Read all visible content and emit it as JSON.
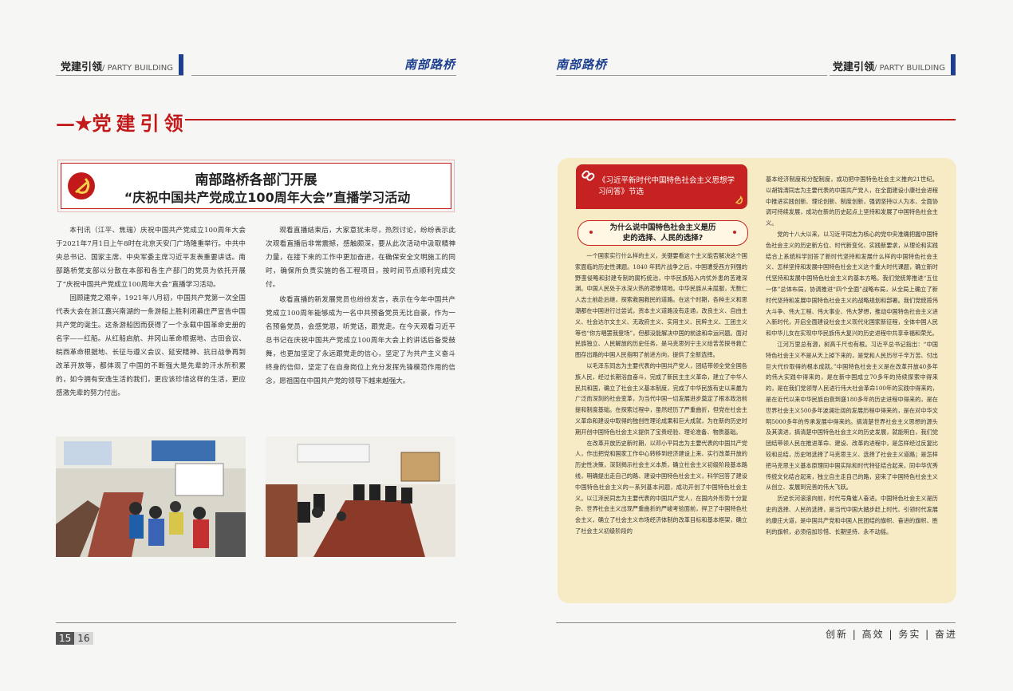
{
  "header": {
    "left_tab_cn": "党建引领",
    "left_tab_en": "/ PARTY BUILDING",
    "right_tab_cn": "党建引领",
    "right_tab_en": "/ PARTY BUILDING",
    "magazine_left": "南部路桥",
    "magazine_right": "南部路桥"
  },
  "section": {
    "prefix": "—★",
    "title": "党建引领"
  },
  "article": {
    "headline_1": "南部路桥各部门开展",
    "headline_2": "“庆祝中国共产党成立100周年大会”直播学习活动",
    "col1_p1": "本刊讯（江平、焦瑞）庆祝中国共产党成立100周年大会于2021年7月1日上午8时在北京天安门广场隆重举行。中共中央总书记、国家主席、中央军委主席习近平发表重要讲话。南部路桥党支部以分散在本部和各生产部门的党员为依托开展了“庆祝中国共产党成立100周年大会”直播学习活动。",
    "col1_p2": "回顾建党之艰辛，1921年八月初，中国共产党第一次全国代表大会在浙江嘉兴南湖的一条游船上胜利闭幕庄严宣告中国共产党的诞生。这条游船因而获得了一个永载中国革命史册的名字——红船。从红船启航、井冈山革命根据地、古田会议、皖西革命根据地、长征与遵义会议、延安精神、抗日战争再到改革开放等，都体现了中国的不断强大是先辈的汗水所积累的，如今拥有安逸生活的我们，更应该珍惜这样的生活，更应感激先辈的努力付出。",
    "col2_p1": "观看直播结束后，大家意犹未尽，热烈讨论，纷纷表示此次观看直播后非常震撼，感触颇深，要从此次活动中汲取精神力量，在接下来的工作中更加奋进，在确保安全文明施工的同时，确保所负责实施的各工程项目，按时间节点顺利完成交付。",
    "col2_p2": "收看直播的新发展党员也纷纷发言，表示在今年中国共产党成立100周年能够成为一名中共预备党员无比自豪，作为一名预备党员，会感党恩，听党话，跟党走。在今天观看习近平总书记在庆祝中国共产党成立100周年大会上的讲话后备受鼓舞，也更加坚定了永远跟党走的信心，坚定了为共产主义奋斗终身的信仰，坚定了在自身岗位上充分发挥先锋模范作用的信念，愿祖国在中国共产党的领导下越来越强大。"
  },
  "right_panel": {
    "book_title": "《习近平新时代中国特色社会主义思想学习问答》节选",
    "question": "为什么说中国特色社会主义是历史的选择、人民的选择?",
    "c1_p1": "一个国家实行什么样的主义，关键要看这个主义能否解决这个国家面临的历史性课题。1840 年鸦片战争之后，中国遭受西方列强的野蛮侵略和封建专制的腐朽统治，中华民族陷入内忧外患的苦难深渊。中国人民处于水深火热的悲惨境地。中华民族从未屈服，无数仁人志士前赴后继，探索救国救民的道路。在这个时期，各种主义和思潮都在中国进行过尝试，资本主义道路没有走通，改良主义、自由主义、社会达尔文主义、无政府主义、实用主义、民粹主义、工团主义等也“你方唱罢我登场”，但都没能解决中国的前途和命运问题。面对民族独立、人民解放的历史任务，是马克思列宁主义给苦苦探寻救亡图存出路的中国人民指明了前进方向，提供了全新选择。",
    "c1_p2": "以毛泽东同志为主要代表的中国共产党人，团结带领全党全国各族人民，经过长期浴血奋斗，完成了新民主主义革命，建立了中华人民共和国，确立了社会主义基本制度，完成了中华民族有史以来最为广泛而深刻的社会变革，为当代中国一切发展进步奠定了根本政治前提和制度基础。在探索过程中，虽然经历了严重曲折，但党在社会主义革命和建设中取得的独创性理论成果和巨大成就，为在新的历史时期开创中国特色社会主义提供了宝贵经验、理论准备、物质基础。",
    "c1_p3": "在改革开放历史新时期，以邓小平同志为主要代表的中国共产党人，作出把党和国家工作中心转移到经济建设上来、实行改革开放的历史性决策，深刻揭示社会主义本质，确立社会主义初级阶段基本路线，明确提出走自己的路、建设中国特色社会主义，科学回答了建设中国特色社会主义的一系列基本问题，成功开创了中国特色社会主义。以江泽民同志为主要代表的中国共产党人，在国内外形势十分复杂、世界社会主义出现严重曲折的严峻考验面前，捍卫了中国特色社会主义，确立了社会主义市场经济体制的改革目标和基本框架，确立了社会主义初级阶段的",
    "c2_p1": "基本经济制度和分配制度，成功把中国特色社会主义推向21世纪。以胡锦涛同志为主要代表的中国共产党人，在全面建设小康社会进程中推进实践创新、理论创新、制度创新，强调坚持以人为本、全面协调可持续发展，成功在新的历史起点上坚持和发展了中国特色社会主义。",
    "c2_p2": "党的十八大以来，以习近平同志为核心的党中央准确把握中国特色社会主义的历史新方位、时代新变化、实践新要求，从理论和实践结合上系统科学回答了新时代坚持和发展什么样的中国特色社会主义、怎样坚持和发展中国特色社会主义这个重大时代课题，确立新时代坚持和发展中国特色社会主义的基本方略。我们党统筹推进“五位一体”总体布局，协调推进“四个全面”战略布局，从全局上确立了新时代坚持和发展中国特色社会主义的战略规划和部署。我们党统揽伟大斗争、伟大工程、伟大事业、伟大梦想，推动中国特色社会主义进入新时代，开启全面建设社会主义现代化国家新征程，全体中国人民和中华儿女在实现中华民族伟大复兴的历史进程中共享幸福和荣光。",
    "c2_p3": "江河万里总有源，树高千尺也有根。习近平总书记指出：“中国特色社会主义不是从天上掉下来的，是党和人民历尽千辛万苦、付出巨大代价取得的根本成就。”中国特色社会主义是在改革开放40多年的伟大实践中得来的，是在新中国成立70多年的持续探索中得来的，是在我们党领导人民进行伟大社会革命100年的实践中得来的，是在近代以来中华民族由衰到盛180多年的历史进程中得来的，是在世界社会主义500多年波澜壮阔的发展历程中得来的，是在对中华文明5000多年的传承发展中得来的。搞清楚世界社会主义思想的源头及其演进，搞清楚中国特色社会主义的历史发展，就能明白，我们党团结带领人民在推进革命、建设、改革的进程中，是怎样经过反复比较和总结，历史地选择了马克思主义、选择了社会主义道路；是怎样把马克思主义基本原理同中国实际和时代特征结合起来，同中华优秀传统文化结合起来，独立自主走自己的路，迎来了中国特色社会主义从创立、发展到完善的伟大飞跃。",
    "c2_p4": "历史长河滚滚向前，时代号角催人奋进。中国特色社会主义是历史的选择、人民的选择，是当代中国大踏步赶上时代、引领时代发展的康庄大道，是中国共产党和中国人民团结的旗帜、奋进的旗帜、胜利的旗帜，必须倍加珍惜、长期坚持、永不动摇。"
  },
  "footer": {
    "page_left": "15",
    "page_right": "16",
    "slogan": "创新 | 高效 | 务实 | 奋进"
  },
  "colors": {
    "party_red": "#c21a1a",
    "brand_blue": "#1c3f8f",
    "panel_bg": "#f7ebc5"
  }
}
